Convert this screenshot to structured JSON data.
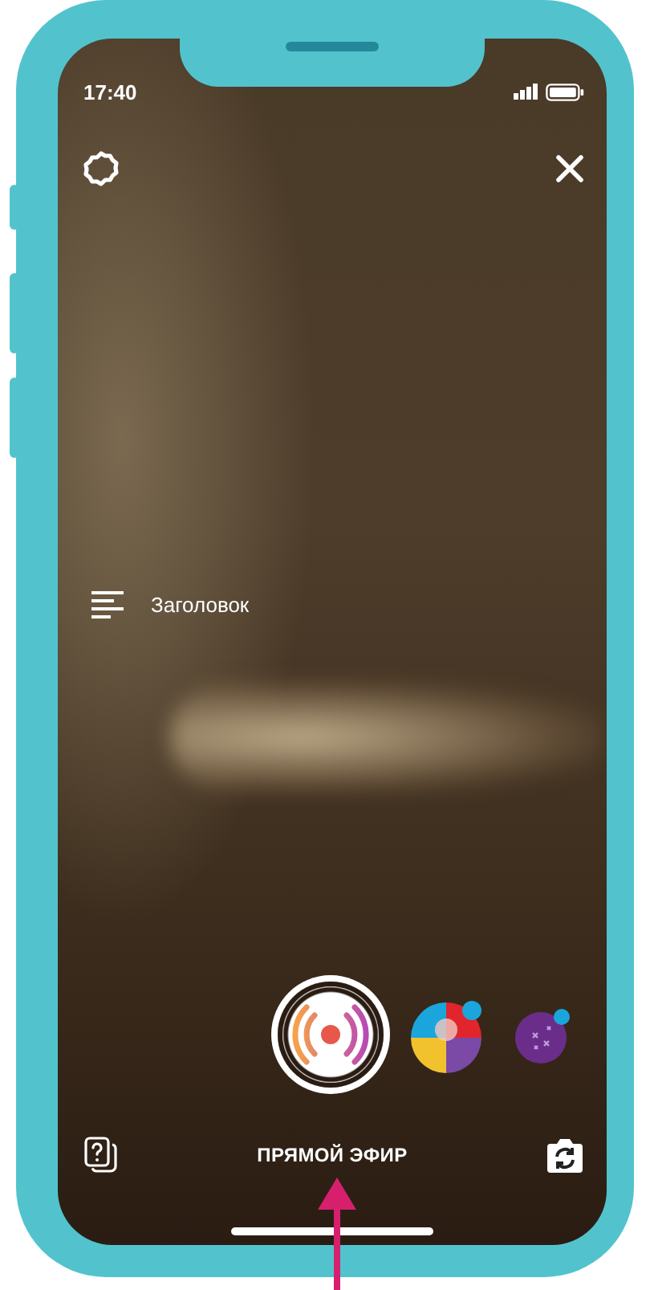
{
  "status_bar": {
    "time": "17:40"
  },
  "text_tool": {
    "label": "Заголовок"
  },
  "mode": {
    "label": "ПРЯМОЙ ЭФИР"
  }
}
